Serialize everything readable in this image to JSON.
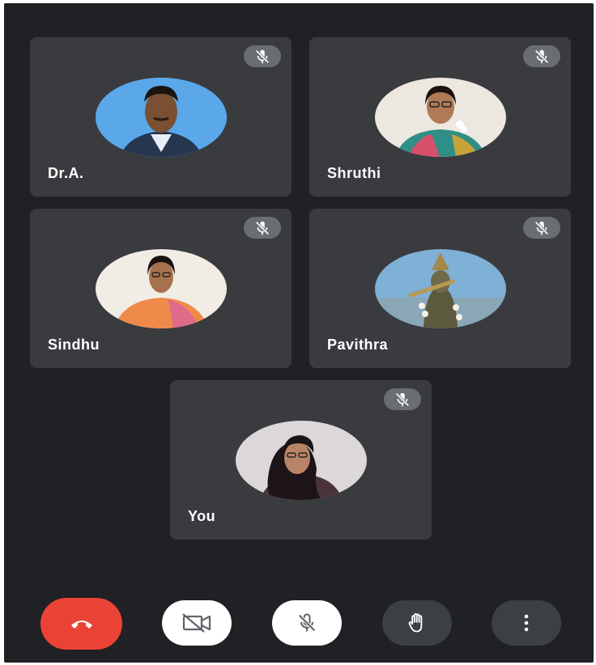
{
  "participants": [
    {
      "name": "Dr.A.",
      "muted": true,
      "avatar_bg": "#4a9be0"
    },
    {
      "name": "Shruthi",
      "muted": true,
      "avatar_bg": "#e8e2d9"
    },
    {
      "name": "Sindhu",
      "muted": true,
      "avatar_bg": "#efe9df"
    },
    {
      "name": "Pavithra",
      "muted": true,
      "avatar_bg": "#6fa2c9"
    },
    {
      "name": "You",
      "muted": true,
      "avatar_bg": "#d9d4d6"
    }
  ],
  "controls": {
    "end_call_icon": "phone-hangup-icon",
    "camera_icon": "camera-off-icon",
    "mic_icon": "mic-off-icon",
    "hand_icon": "raise-hand-icon",
    "more_icon": "more-vertical-icon"
  },
  "colors": {
    "background": "#202124",
    "tile": "#3a3b3f",
    "end_call": "#ea4335",
    "mute_badge": "#6a6d72"
  }
}
